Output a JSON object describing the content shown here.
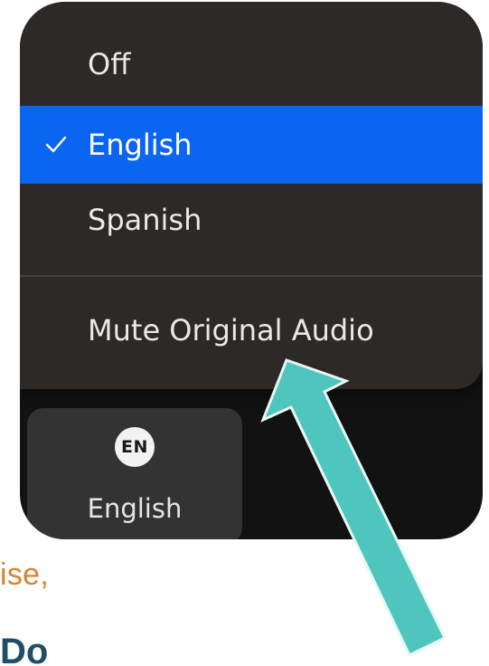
{
  "menu": {
    "items": [
      {
        "label": "Off",
        "checked": false,
        "selected": false
      },
      {
        "label": "English",
        "checked": true,
        "selected": true
      },
      {
        "label": "Spanish",
        "checked": false,
        "selected": false
      },
      {
        "label": "Mute Original Audio",
        "checked": false,
        "selected": false
      }
    ]
  },
  "toolbar": {
    "language_button": {
      "badge": "EN",
      "label": "English"
    }
  },
  "background_text": {
    "fragment_orange": "ise,",
    "fragment_dark": "Do"
  },
  "colors": {
    "menu_bg": "#2c2926",
    "selection": "#0a66f0",
    "arrow_fill": "#4fc6bd",
    "arrow_stroke": "#e8f7f6",
    "orange_text": "#d9822b",
    "dark_text": "#1f4e66"
  },
  "icons": {
    "check": "checkmark-icon",
    "arrow": "annotation-arrow"
  }
}
